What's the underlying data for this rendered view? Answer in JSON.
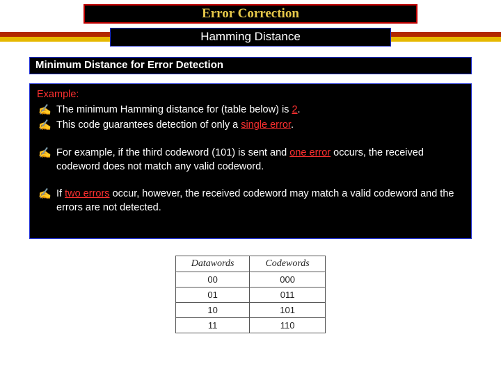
{
  "title": "Error Correction",
  "subtitle": "Hamming Distance",
  "section": "Minimum Distance for Error Detection",
  "example_label": "Example:",
  "bullets": {
    "b1_pre": "The minimum Hamming distance for (table below) is ",
    "b1_hl": "2",
    "b1_post": ".",
    "b2_pre": "This code guarantees detection of only a ",
    "b2_hl": "single error",
    "b2_post": ".",
    "b3_pre": "For example, if the third codeword (101) is sent and ",
    "b3_hl": "one error",
    "b3_post": " occurs, the received codeword does not match any valid codeword.",
    "b4_pre": "If ",
    "b4_hl": "two errors",
    "b4_post": " occur, however, the received codeword may match a valid codeword and the errors are not detected."
  },
  "table": {
    "headers": {
      "c1": "Datawords",
      "c2": "Codewords"
    },
    "rows": [
      {
        "d": "00",
        "c": "000"
      },
      {
        "d": "01",
        "c": "011"
      },
      {
        "d": "10",
        "c": "101"
      },
      {
        "d": "11",
        "c": "110"
      }
    ]
  },
  "chart_data": {
    "type": "table",
    "title": "Dataword to Codeword mapping",
    "columns": [
      "Datawords",
      "Codewords"
    ],
    "rows": [
      [
        "00",
        "000"
      ],
      [
        "01",
        "011"
      ],
      [
        "10",
        "101"
      ],
      [
        "11",
        "110"
      ]
    ],
    "min_hamming_distance": 2
  }
}
